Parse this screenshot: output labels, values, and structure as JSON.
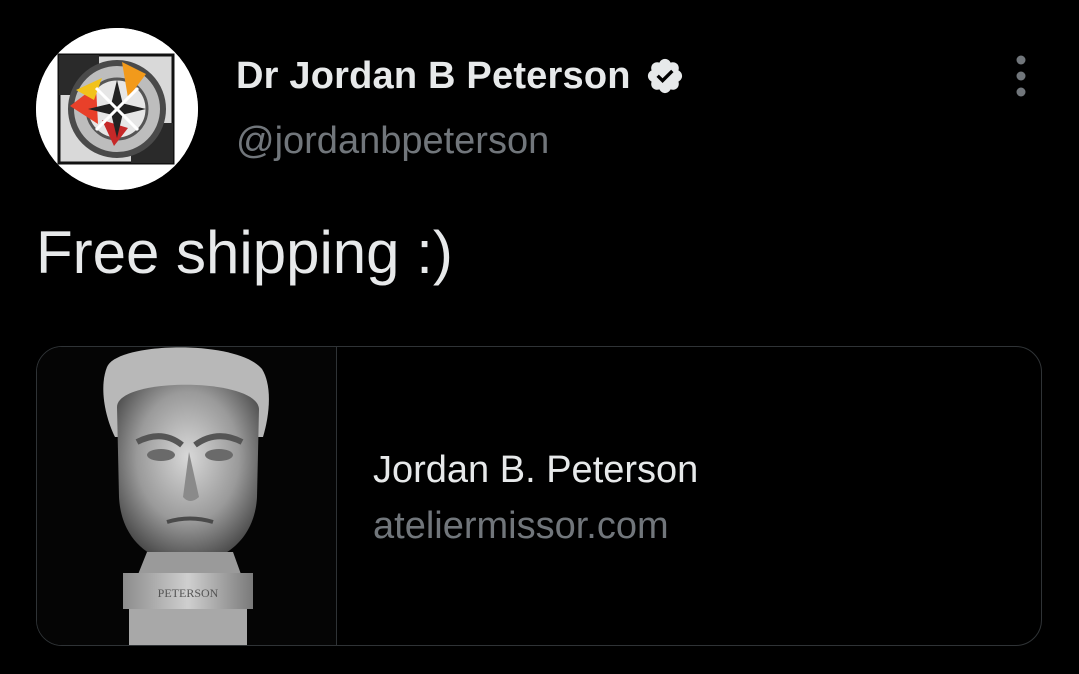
{
  "author": {
    "display_name": "Dr Jordan B Peterson",
    "handle": "@jordanbpeterson",
    "verified": true,
    "verified_icon": "verified-badge-icon"
  },
  "tweet": {
    "text": "Free shipping :)"
  },
  "menu": {
    "icon": "more-options-icon"
  },
  "link_card": {
    "title": "Jordan B. Peterson",
    "domain": "ateliermissor.com",
    "image_plinth_text": "PETERSON"
  },
  "colors": {
    "background": "#000000",
    "primary_text": "#e7e9ea",
    "secondary_text": "#71767b",
    "border": "#2f3336"
  }
}
